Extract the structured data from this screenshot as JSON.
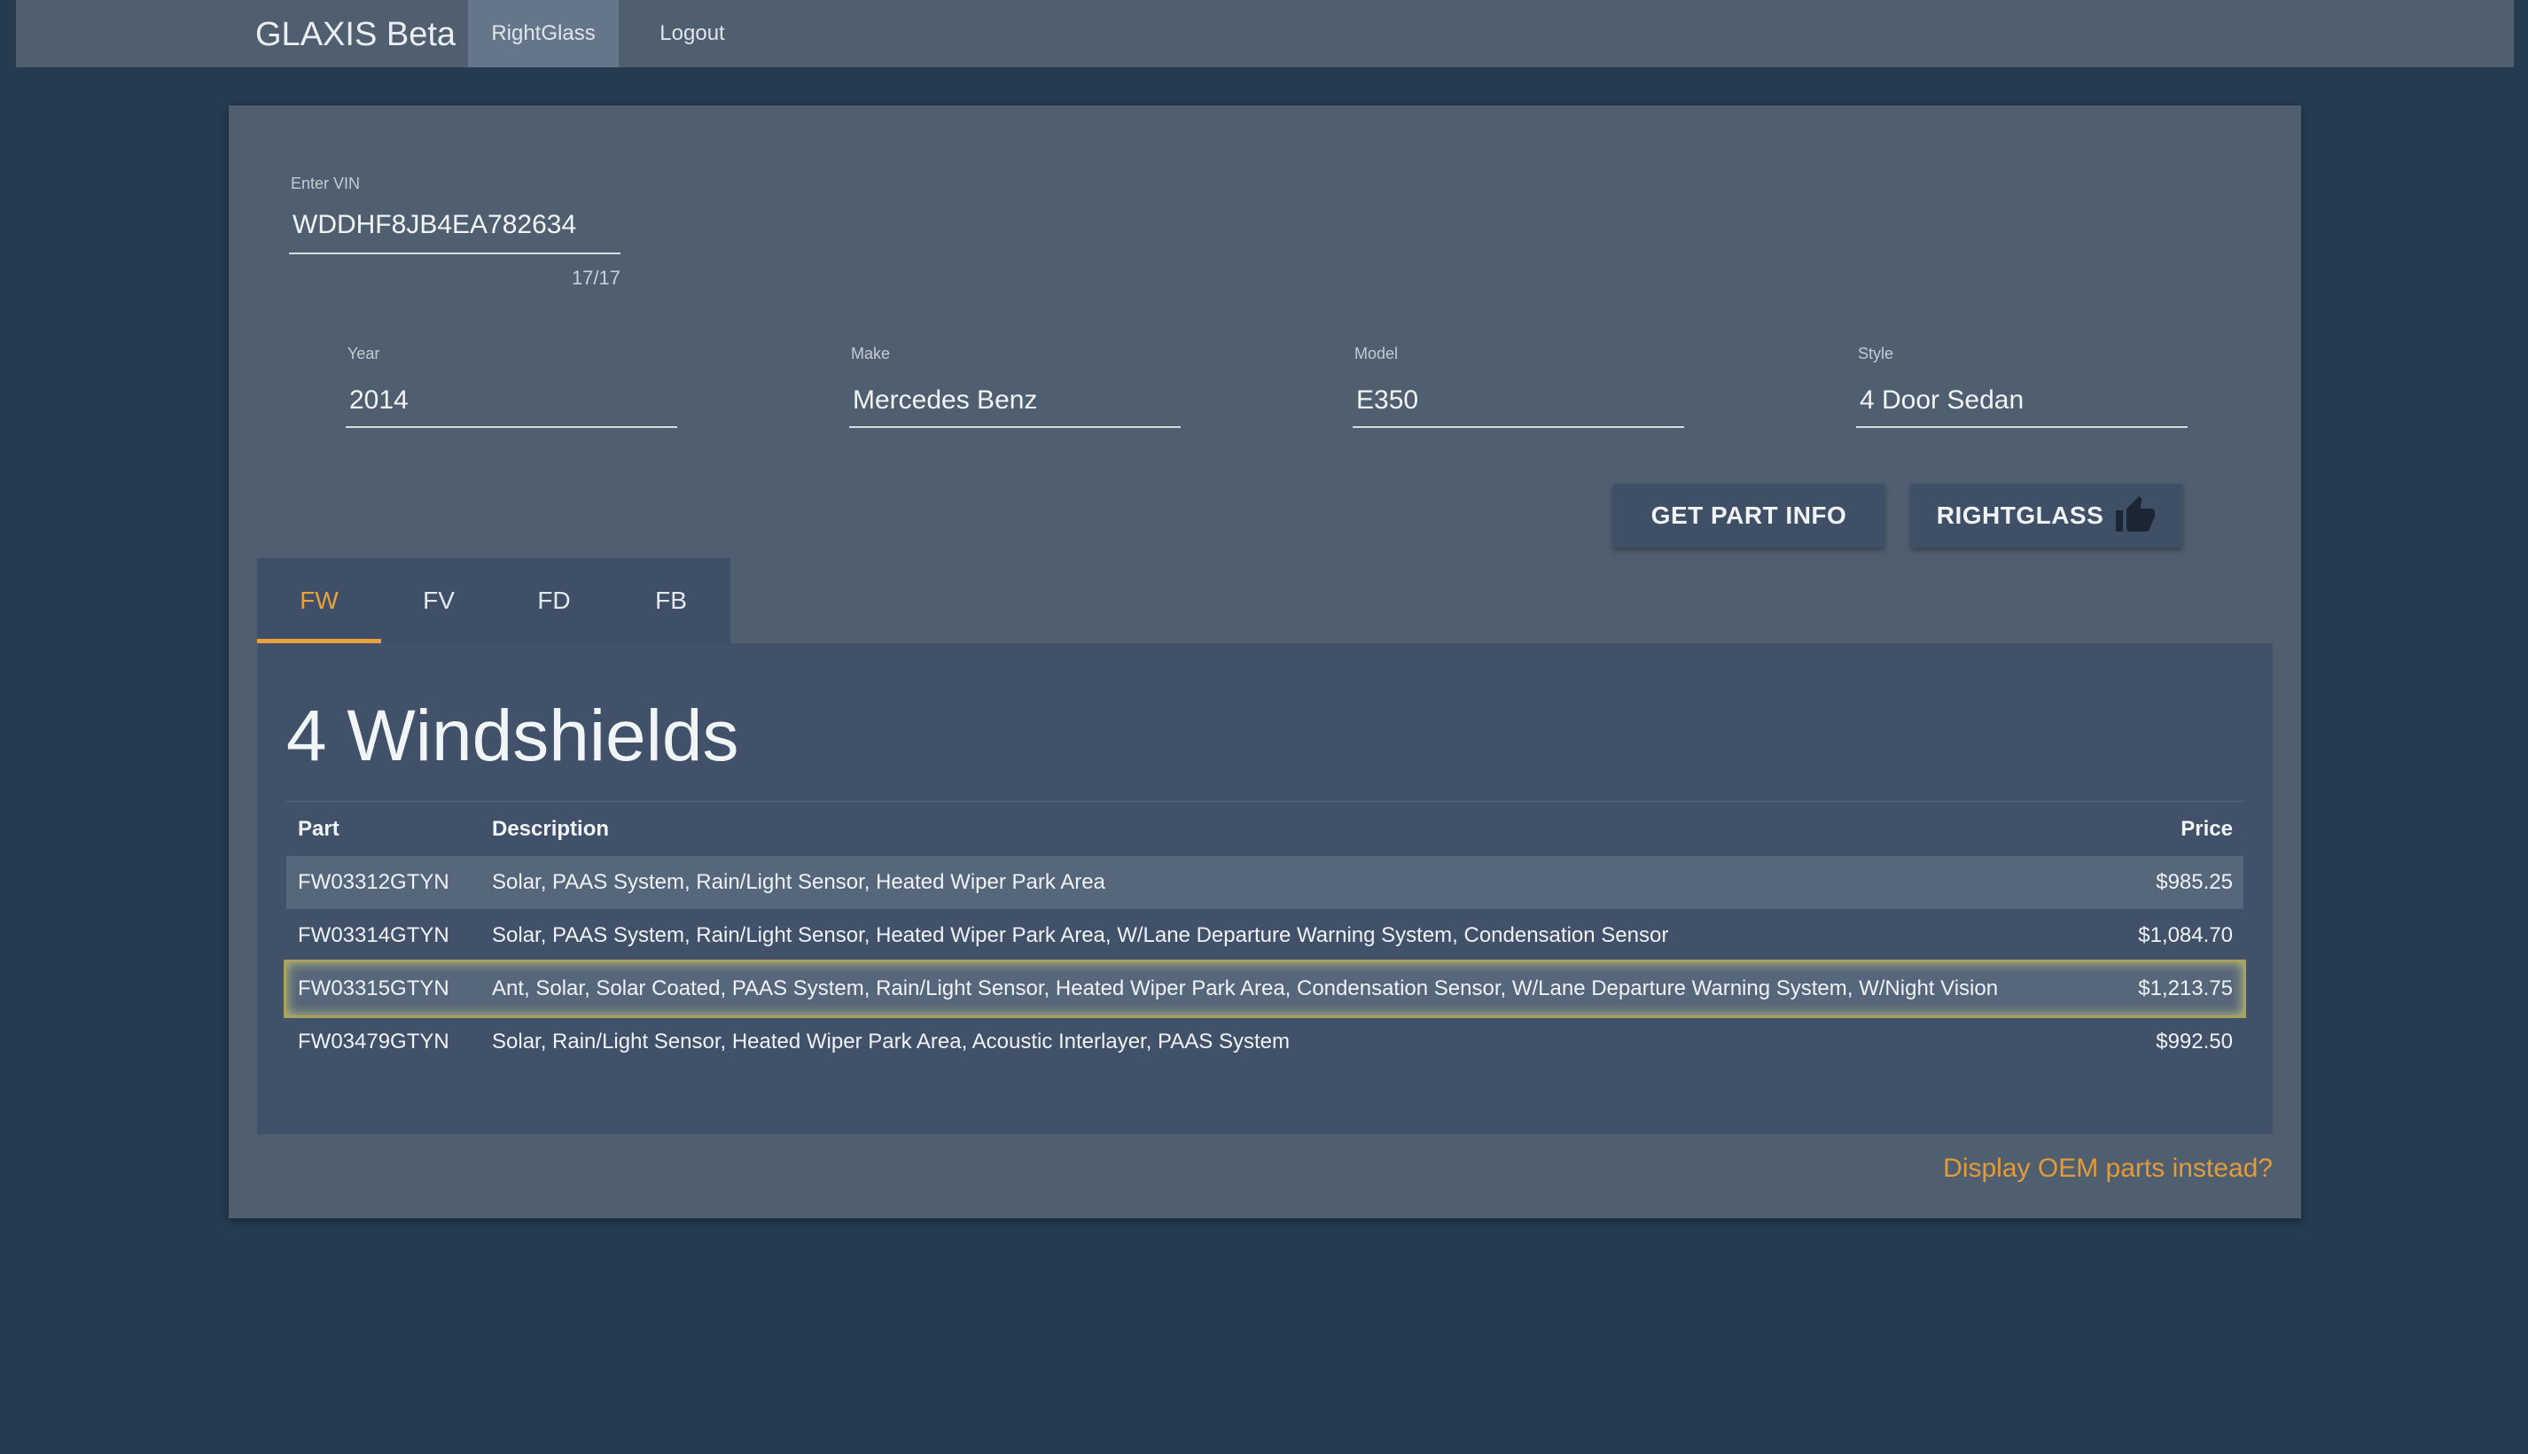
{
  "nav": {
    "brand": "GLAXIS Beta",
    "items": [
      {
        "label": "RightGlass",
        "active": true
      },
      {
        "label": "Logout",
        "active": false
      }
    ]
  },
  "vin": {
    "label": "Enter VIN",
    "value": "WDDHF8JB4EA782634",
    "counter": "17/17"
  },
  "vehicle": {
    "year": {
      "label": "Year",
      "value": "2014"
    },
    "make": {
      "label": "Make",
      "value": "Mercedes Benz"
    },
    "model": {
      "label": "Model",
      "value": "E350"
    },
    "style": {
      "label": "Style",
      "value": "4 Door Sedan"
    }
  },
  "actions": {
    "get_part_info": "GET PART INFO",
    "rightglass": "RIGHTGLASS",
    "rightglass_icon": "thumbs-up-icon"
  },
  "tabs": [
    {
      "label": "FW",
      "active": true
    },
    {
      "label": "FV",
      "active": false
    },
    {
      "label": "FD",
      "active": false
    },
    {
      "label": "FB",
      "active": false
    }
  ],
  "results": {
    "title": "4 Windshields",
    "columns": [
      "Part",
      "Description",
      "Price"
    ],
    "rows": [
      {
        "part": "FW03312GTYN",
        "description": "Solar, PAAS System, Rain/Light Sensor, Heated Wiper Park Area",
        "price": "$985.25",
        "selected": false
      },
      {
        "part": "FW03314GTYN",
        "description": "Solar, PAAS System, Rain/Light Sensor, Heated Wiper Park Area, W/Lane Departure Warning System, Condensation Sensor",
        "price": "$1,084.70",
        "selected": false
      },
      {
        "part": "FW03315GTYN",
        "description": "Ant, Solar, Solar Coated, PAAS System, Rain/Light Sensor, Heated Wiper Park Area, Condensation Sensor, W/Lane Departure Warning System, W/Night Vision",
        "price": "$1,213.75",
        "selected": true
      },
      {
        "part": "FW03479GTYN",
        "description": "Solar, Rain/Light Sensor, Heated Wiper Park Area, Acoustic Interlayer, PAAS System",
        "price": "$992.50",
        "selected": false
      }
    ]
  },
  "oem_link": "Display OEM parts instead?",
  "colors": {
    "accent": "#e9a23b",
    "background": "#263a50",
    "card": "#4f5f70",
    "panel": "#415169",
    "highlight": "#a7a35a"
  }
}
